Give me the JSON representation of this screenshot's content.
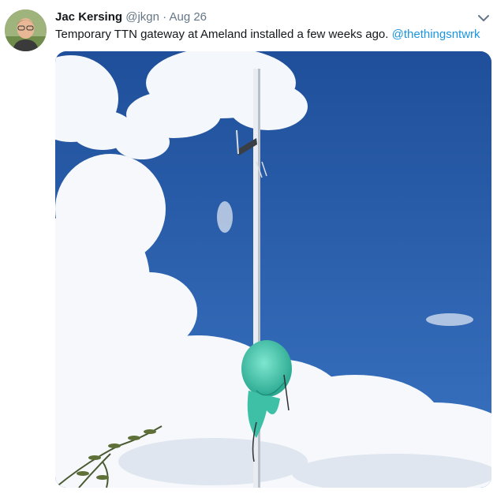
{
  "tweet": {
    "author_name": "Jac Kersing",
    "author_handle": "@jkgn",
    "separator": "·",
    "date": "Aug 26",
    "text": "Temporary TTN gateway at Ameland installed a few weeks ago. ",
    "mention": "@thethingsntwrk",
    "avatar_icon": "user-avatar",
    "menu_icon": "chevron-down-icon"
  },
  "colors": {
    "name": "#14171a",
    "meta": "#657786",
    "link": "#1b95e0",
    "sky": "#2a5fa8"
  }
}
